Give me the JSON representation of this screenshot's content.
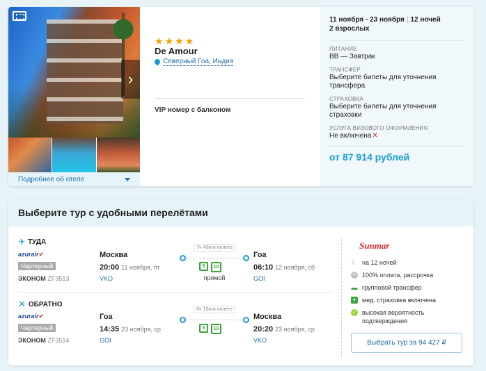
{
  "hotel": {
    "more_label": "Подробнее об отеле",
    "stars": 4,
    "name": "De Amour",
    "location": "Северный Гоа, Индия",
    "room": "VIP номер с балконом",
    "dates": "11 ноября - 23 ноября",
    "nights": "12 ночей",
    "persons": "2 взрослых",
    "sections": [
      {
        "title": "ПИТАНИЕ",
        "value": "BB — Завтрак"
      },
      {
        "title": "ТРАНСФЕР",
        "value": "Выберите билеты для уточнения трансфера"
      },
      {
        "title": "СТРАХОВКА",
        "value": "Выберите билеты для уточнения страховки"
      },
      {
        "title": "УСЛУГА ВИЗОВОГО ОФОРМЛЕНИЯ",
        "value": "Не включена"
      }
    ],
    "price": "от 87 914 рублей"
  },
  "flights": {
    "header": "Выберите тур с удобными перелётами",
    "out": {
      "direction": "ТУДА",
      "airline": "azurair",
      "charter": "Чартерный",
      "class": "ЭКОНОМ",
      "flight": "ZF3513",
      "from_city": "Москва",
      "from_time": "20:00",
      "from_date": "11 ноября, пт",
      "from_code": "VKO",
      "duration": "7ч 40м в полете",
      "bag1": "5",
      "bag2": "10",
      "direct": "прямой",
      "to_city": "Гоа",
      "to_time": "06:10",
      "to_date": "12 ноября, сб",
      "to_code": "GOI"
    },
    "ret": {
      "direction": "ОБРАТНО",
      "airline": "azurair",
      "charter": "Чартерный",
      "class": "ЭКОНОМ",
      "flight": "ZF3514",
      "from_city": "Гоа",
      "from_time": "14:35",
      "from_date": "23 ноября, ср",
      "from_code": "GOI",
      "duration": "8ч 15м в полете",
      "bag1": "5",
      "bag2": "10",
      "to_city": "Москва",
      "to_time": "20:20",
      "to_date": "23 ноября, ср",
      "to_code": "VKO"
    },
    "operator": "Sunmar",
    "features": [
      "на 12 ночей",
      "100% оплата, рассрочка",
      "групповой трансфер",
      "мед. страховка включена",
      "высокая вероятность подтверждения"
    ],
    "select_label": "Выбрать тур за 94 427 ₽"
  },
  "colors": {
    "accent": "#1b9ad6",
    "star": "#f4a300",
    "success": "#3aa63a",
    "error": "#e03030",
    "brand": "#d0262b"
  },
  "icons": [
    "fullscreen-icon",
    "chevron-right-icon",
    "chevron-down-icon",
    "star-icon",
    "location-pin-icon",
    "plane-icon",
    "return-icon",
    "baggage-icon",
    "moon-icon",
    "percent-icon",
    "bus-icon",
    "medical-icon",
    "check-icon",
    "cross-icon"
  ]
}
